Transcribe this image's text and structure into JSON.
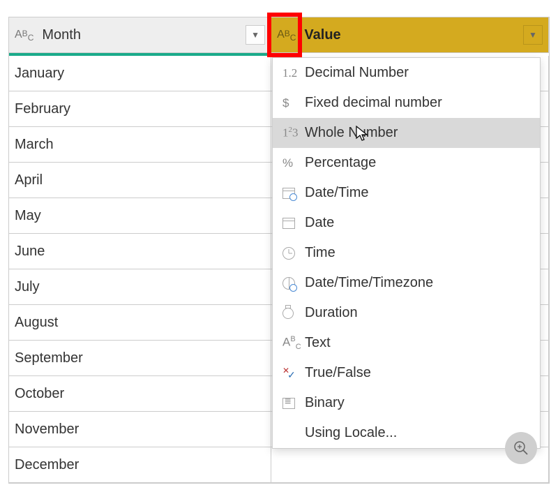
{
  "columns": {
    "month": {
      "label": "Month",
      "type_icon": "text-type"
    },
    "value": {
      "label": "Value",
      "type_icon": "text-type"
    }
  },
  "rows": [
    "January",
    "February",
    "March",
    "April",
    "May",
    "June",
    "July",
    "August",
    "September",
    "October",
    "November",
    "December"
  ],
  "type_menu": {
    "items": [
      {
        "icon": "decimal",
        "label": "Decimal Number"
      },
      {
        "icon": "currency",
        "label": "Fixed decimal number"
      },
      {
        "icon": "whole",
        "label": "Whole Number",
        "hovered": true
      },
      {
        "icon": "percent",
        "label": "Percentage"
      },
      {
        "icon": "datetime",
        "label": "Date/Time"
      },
      {
        "icon": "date",
        "label": "Date"
      },
      {
        "icon": "time",
        "label": "Time"
      },
      {
        "icon": "dtz",
        "label": "Date/Time/Timezone"
      },
      {
        "icon": "duration",
        "label": "Duration"
      },
      {
        "icon": "text",
        "label": "Text"
      },
      {
        "icon": "bool",
        "label": "True/False"
      },
      {
        "icon": "binary",
        "label": "Binary"
      },
      {
        "icon": "",
        "label": "Using Locale..."
      }
    ]
  }
}
